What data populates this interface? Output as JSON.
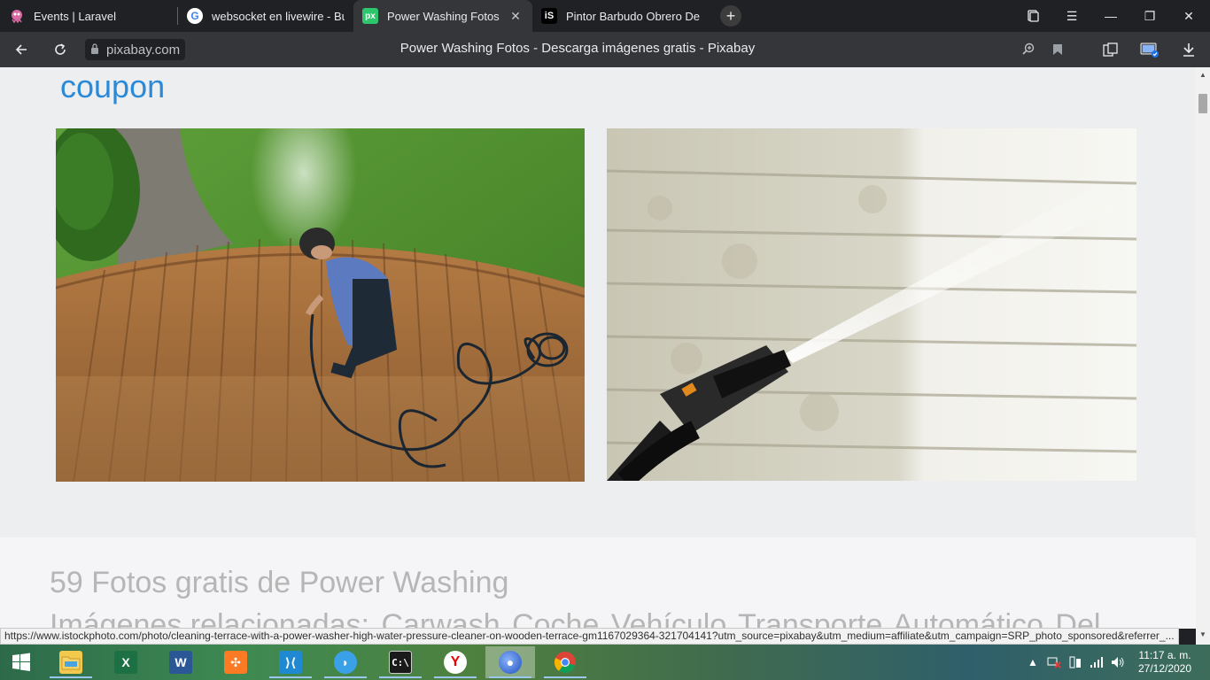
{
  "tabs": [
    {
      "title": "Events | Laravel",
      "favicon": "laravel-icon",
      "active": false
    },
    {
      "title": "websocket en livewire - Bu",
      "favicon": "google-icon",
      "active": false
    },
    {
      "title": "Power Washing Fotos - D",
      "favicon": "pixabay-icon",
      "favicon_text": "px",
      "active": true
    },
    {
      "title": "Pintor Barbudo Obrero De",
      "favicon": "istock-icon",
      "favicon_text": "iS",
      "active": false
    }
  ],
  "new_tab_label": "+",
  "address": {
    "url": "pixabay.com"
  },
  "page_title": "Power Washing Fotos - Descarga imágenes gratis - Pixabay",
  "content": {
    "coupon_text": "coupon",
    "photo_left_alt": "Hombre limpiando terraza de madera con hidrolavadora",
    "photo_right_alt": "Lanza de hidrolavadora limpiando revestimiento",
    "results_heading": "59 Fotos gratis de Power Washing",
    "related_label": "Imágenes relacionadas:",
    "related_items": [
      "Carwash",
      "Coche",
      "Vehículo",
      "Transporte",
      "Automático",
      "Del"
    ]
  },
  "status_url": "https://www.istockphoto.com/photo/cleaning-terrace-with-a-power-washer-high-water-pressure-cleaner-on-wooden-terrace-gm1167029364-321704141?utm_source=pixabay&utm_medium=affiliate&utm_campaign=SRP_photo_sponsored&referrer_...",
  "taskbar": {
    "apps": [
      "windows-start",
      "file-explorer",
      "excel",
      "word",
      "xampp",
      "vscode",
      "tableplus",
      "terminal",
      "yandex-browser",
      "firefox",
      "chrome"
    ],
    "clock_time": "11:17 a. m.",
    "clock_date": "27/12/2020"
  },
  "colors": {
    "accent": "#2a8ad8",
    "tab_active": "#35363a",
    "tab_strip": "#202124"
  }
}
